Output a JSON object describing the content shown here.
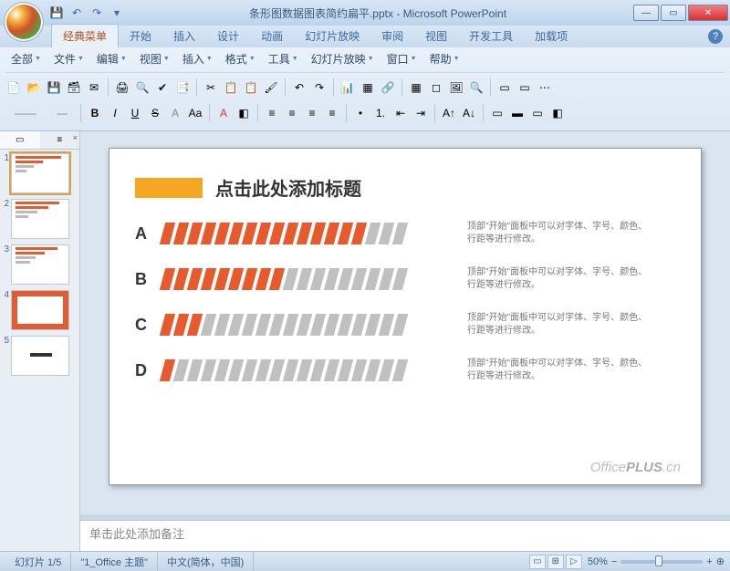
{
  "window": {
    "title": "条形图数据图表简约扁平.pptx - Microsoft PowerPoint"
  },
  "qat": {
    "save": "💾",
    "undo": "↶",
    "redo": "↷"
  },
  "tabs": [
    "经典菜单",
    "开始",
    "插入",
    "设计",
    "动画",
    "幻灯片放映",
    "审阅",
    "视图",
    "开发工具",
    "加载项"
  ],
  "menubar": [
    "全部",
    "文件",
    "编辑",
    "视图",
    "插入",
    "格式",
    "工具",
    "幻灯片放映",
    "窗口",
    "帮助"
  ],
  "thumb_tabs": {
    "slides": "",
    "outline": "",
    "close": "x"
  },
  "slide": {
    "title": "点击此处添加标题",
    "rows": [
      {
        "label": "A",
        "filled": 15,
        "total": 18,
        "desc": "顶部\"开始\"面板中可以对字体、字号、颜色、行距等进行修改。"
      },
      {
        "label": "B",
        "filled": 9,
        "total": 18,
        "desc": "顶部\"开始\"面板中可以对字体、字号、颜色、行距等进行修改。"
      },
      {
        "label": "C",
        "filled": 3,
        "total": 18,
        "desc": "顶部\"开始\"面板中可以对字体、字号、颜色、行距等进行修改。"
      },
      {
        "label": "D",
        "filled": 1,
        "total": 18,
        "desc": "顶部\"开始\"面板中可以对字体、字号、颜色、行距等进行修改。"
      }
    ],
    "watermark_a": "Office",
    "watermark_b": "PLUS",
    "watermark_c": ".cn"
  },
  "notes": {
    "placeholder": "单击此处添加备注"
  },
  "status": {
    "slide_counter": "幻灯片 1/5",
    "theme": "\"1_Office 主题\"",
    "lang": "中文(简体，中国)",
    "zoom": "50%",
    "fit": "⊕"
  },
  "chart_data": {
    "type": "bar",
    "title": "点击此处添加标题",
    "categories": [
      "A",
      "B",
      "C",
      "D"
    ],
    "values": [
      15,
      9,
      3,
      1
    ],
    "max": 18,
    "xlabel": "",
    "ylabel": "",
    "ylim": [
      0,
      18
    ]
  }
}
